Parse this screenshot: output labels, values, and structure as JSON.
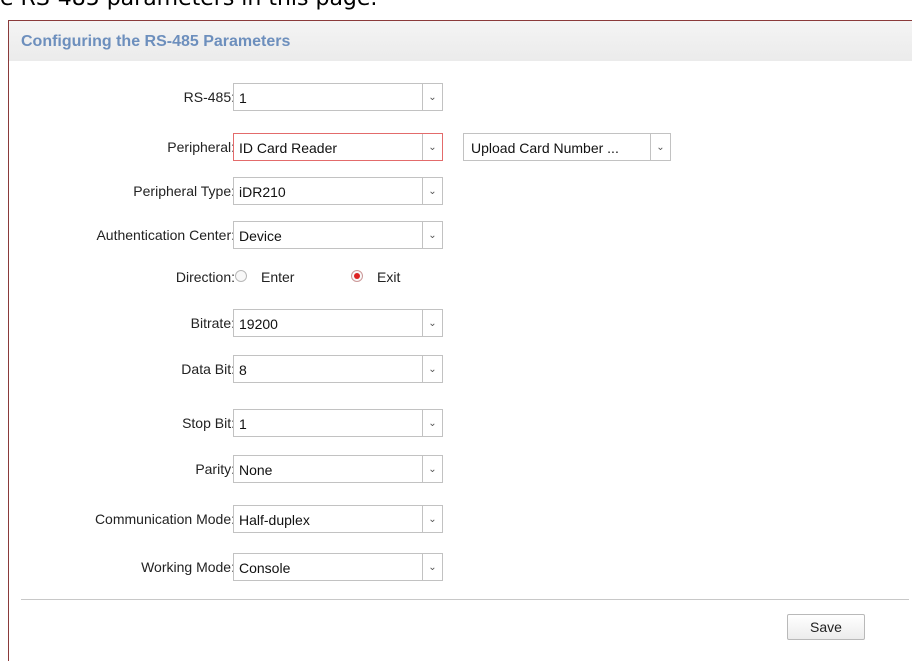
{
  "caption": "e RS-485 parameters in this page.",
  "header": {
    "title": "Configuring the RS-485 Parameters"
  },
  "fields": {
    "rs485": {
      "label": "RS-485:",
      "value": "1"
    },
    "peripheral": {
      "label": "Peripheral:",
      "value": "ID Card Reader",
      "extra_value": "Upload Card Number ..."
    },
    "peripheral_type": {
      "label": "Peripheral Type:",
      "value": "iDR210"
    },
    "auth_center": {
      "label": "Authentication Center:",
      "value": "Device"
    },
    "direction": {
      "label": "Direction:",
      "options": [
        "Enter",
        "Exit"
      ],
      "selected": "Exit"
    },
    "bitrate": {
      "label": "Bitrate:",
      "value": "19200"
    },
    "data_bit": {
      "label": "Data Bit:",
      "value": "8"
    },
    "stop_bit": {
      "label": "Stop Bit:",
      "value": "1"
    },
    "parity": {
      "label": "Parity:",
      "value": "None"
    },
    "comm_mode": {
      "label": "Communication Mode:",
      "value": "Half-duplex"
    },
    "working_mode": {
      "label": "Working Mode:",
      "value": "Console"
    }
  },
  "icons": {
    "dropdown": "chevron-down-icon"
  },
  "colors": {
    "title": "#6d8fbd",
    "active_border": "#e36b6b",
    "radio_selected": "#dd2222"
  },
  "buttons": {
    "save": "Save"
  }
}
